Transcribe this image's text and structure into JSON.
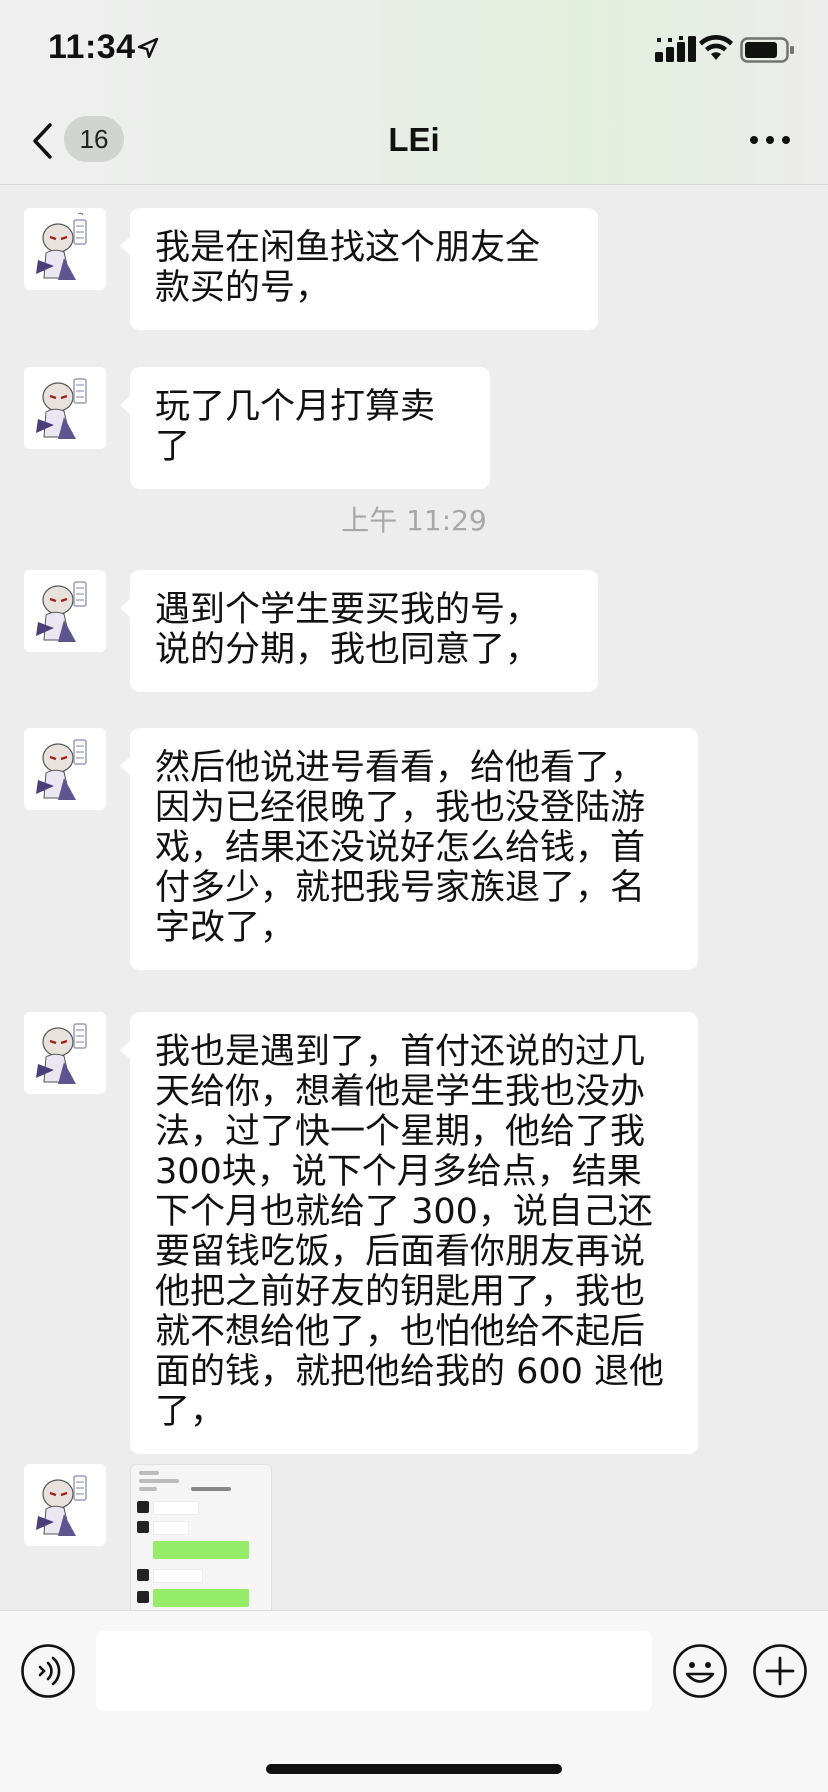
{
  "status_bar": {
    "time": "11:34",
    "icons": [
      "location-arrow-icon",
      "cellular-signal-icon",
      "wifi-icon",
      "battery-icon"
    ]
  },
  "nav": {
    "back_icon": "chevron-left-icon",
    "unread_count": "16",
    "title": "LEi",
    "more_icon": "ellipsis-icon"
  },
  "messages": [
    {
      "type": "text",
      "text": "我是在闲鱼找这个朋友全款买的号，"
    },
    {
      "type": "text",
      "text": "玩了几个月打算卖了"
    },
    {
      "type": "time",
      "text": "上午 11:29"
    },
    {
      "type": "text",
      "text": "遇到个学生要买我的号，说的分期，我也同意了，"
    },
    {
      "type": "text",
      "text": "然后他说进号看看，给他看了，因为已经很晚了，我也没登陆游戏，结果还没说好怎么给钱，首付多少，就把我号家族退了，名字改了，"
    },
    {
      "type": "text",
      "text": "我也是遇到了，首付还说的过几天给你，想着他是学生我也没办法，过了快一个星期，他给了我 300块，说下个月多给点，结果下个月也就给了 300，说自己还要留钱吃饭，后面看你朋友再说他把之前好友的钥匙用了，我也就不想给他了，也怕他给不起后面的钱，就把他给我的 600 退他了，"
    },
    {
      "type": "image",
      "text": ""
    }
  ],
  "input_bar": {
    "voice_icon": "voice-icon",
    "placeholder": "",
    "emoji_icon": "emoji-icon",
    "plus_icon": "plus-circle-icon"
  },
  "colors": {
    "background": "#ededed",
    "bubble": "#ffffff",
    "accent_green": "#95ec69"
  }
}
